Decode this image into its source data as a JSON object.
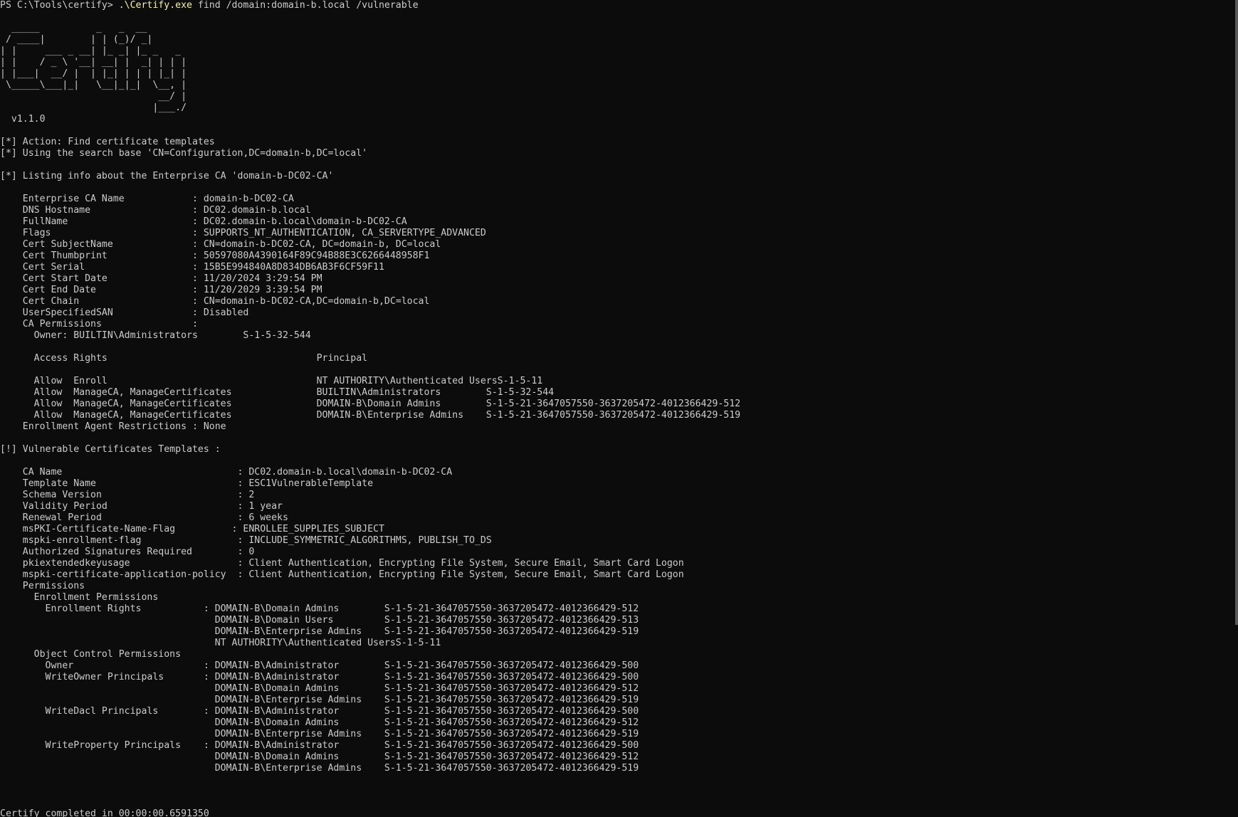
{
  "theme": {
    "background": "#0c0c0c",
    "foreground": "#cccccc",
    "command_highlight": "#f9f1a5"
  },
  "prompt": {
    "path": "PS C:\\Tools\\certify> ",
    "exe": ".\\Certify.exe",
    "args": " find /domain:domain-b.local /vulnerable"
  },
  "output": [
    "",
    "  _____          _   _  __",
    " / ____|        | | (_)/ _|",
    "| |     ___ _ __| |_ _| |_ _   _",
    "| |    / _ \\ '__| __| |  _| | | |",
    "| |___|  __/ |  | |_| | | | |_| |",
    " \\_____\\___|_|   \\__|_|_|  \\__, |",
    "                            __/ |",
    "                           |___./",
    "  v1.1.0",
    "",
    "[*] Action: Find certificate templates",
    "[*] Using the search base 'CN=Configuration,DC=domain-b,DC=local'",
    "",
    "[*] Listing info about the Enterprise CA 'domain-b-DC02-CA'",
    "",
    "    Enterprise CA Name            : domain-b-DC02-CA",
    "    DNS Hostname                  : DC02.domain-b.local",
    "    FullName                      : DC02.domain-b.local\\domain-b-DC02-CA",
    "    Flags                         : SUPPORTS_NT_AUTHENTICATION, CA_SERVERTYPE_ADVANCED",
    "    Cert SubjectName              : CN=domain-b-DC02-CA, DC=domain-b, DC=local",
    "    Cert Thumbprint               : 50597080A4390164F89C94B88E3C6266448958F1",
    "    Cert Serial                   : 15B5E994840A8D834DB6AB3F6CF59F11",
    "    Cert Start Date               : 11/20/2024 3:29:54 PM",
    "    Cert End Date                 : 11/20/2029 3:39:54 PM",
    "    Cert Chain                    : CN=domain-b-DC02-CA,DC=domain-b,DC=local",
    "    UserSpecifiedSAN              : Disabled",
    "    CA Permissions                :",
    "      Owner: BUILTIN\\Administrators        S-1-5-32-544",
    "",
    "      Access Rights                                     Principal",
    "",
    "      Allow  Enroll                                     NT AUTHORITY\\Authenticated UsersS-1-5-11",
    "      Allow  ManageCA, ManageCertificates               BUILTIN\\Administrators        S-1-5-32-544",
    "      Allow  ManageCA, ManageCertificates               DOMAIN-B\\Domain Admins        S-1-5-21-3647057550-3637205472-4012366429-512",
    "      Allow  ManageCA, ManageCertificates               DOMAIN-B\\Enterprise Admins    S-1-5-21-3647057550-3637205472-4012366429-519",
    "    Enrollment Agent Restrictions : None",
    "",
    "[!] Vulnerable Certificates Templates :",
    "",
    "    CA Name                               : DC02.domain-b.local\\domain-b-DC02-CA",
    "    Template Name                         : ESC1VulnerableTemplate",
    "    Schema Version                        : 2",
    "    Validity Period                       : 1 year",
    "    Renewal Period                        : 6 weeks",
    "    msPKI-Certificate-Name-Flag          : ENROLLEE_SUPPLIES_SUBJECT",
    "    mspki-enrollment-flag                 : INCLUDE_SYMMETRIC_ALGORITHMS, PUBLISH_TO_DS",
    "    Authorized Signatures Required        : 0",
    "    pkiextendedkeyusage                   : Client Authentication, Encrypting File System, Secure Email, Smart Card Logon",
    "    mspki-certificate-application-policy  : Client Authentication, Encrypting File System, Secure Email, Smart Card Logon",
    "    Permissions",
    "      Enrollment Permissions",
    "        Enrollment Rights           : DOMAIN-B\\Domain Admins        S-1-5-21-3647057550-3637205472-4012366429-512",
    "                                      DOMAIN-B\\Domain Users         S-1-5-21-3647057550-3637205472-4012366429-513",
    "                                      DOMAIN-B\\Enterprise Admins    S-1-5-21-3647057550-3637205472-4012366429-519",
    "                                      NT AUTHORITY\\Authenticated UsersS-1-5-11",
    "      Object Control Permissions",
    "        Owner                       : DOMAIN-B\\Administrator        S-1-5-21-3647057550-3637205472-4012366429-500",
    "        WriteOwner Principals       : DOMAIN-B\\Administrator        S-1-5-21-3647057550-3637205472-4012366429-500",
    "                                      DOMAIN-B\\Domain Admins        S-1-5-21-3647057550-3637205472-4012366429-512",
    "                                      DOMAIN-B\\Enterprise Admins    S-1-5-21-3647057550-3637205472-4012366429-519",
    "        WriteDacl Principals        : DOMAIN-B\\Administrator        S-1-5-21-3647057550-3637205472-4012366429-500",
    "                                      DOMAIN-B\\Domain Admins        S-1-5-21-3647057550-3637205472-4012366429-512",
    "                                      DOMAIN-B\\Enterprise Admins    S-1-5-21-3647057550-3637205472-4012366429-519",
    "        WriteProperty Principals    : DOMAIN-B\\Administrator        S-1-5-21-3647057550-3637205472-4012366429-500",
    "                                      DOMAIN-B\\Domain Admins        S-1-5-21-3647057550-3637205472-4012366429-512",
    "                                      DOMAIN-B\\Enterprise Admins    S-1-5-21-3647057550-3637205472-4012366429-519",
    "",
    "",
    "",
    "Certify completed in 00:00:00.6591350"
  ]
}
